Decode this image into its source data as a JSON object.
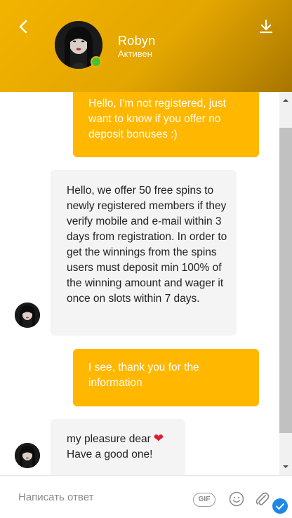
{
  "header": {
    "name": "Robyn",
    "status": "Активен",
    "online_color": "#41c23b",
    "background_color": "#f3b300"
  },
  "messages": [
    {
      "direction": "outgoing",
      "text": "Hello, I'm not registered, just want to know if you offer no deposit bonuses :)"
    },
    {
      "direction": "incoming",
      "text": "Hello, we offer 50 free spins to newly registered members if they verify mobile and e-mail within 3 days from registration. In order to get the winnings from the spins users must deposit min 100% of the winning amount and wager it once on slots within 7 days."
    },
    {
      "direction": "outgoing",
      "text": "I see, thank you for the information"
    },
    {
      "direction": "incoming",
      "text_line1": "my pleasure dear",
      "emoji": "heart",
      "text_line2": "Have a good one!"
    }
  ],
  "composer": {
    "placeholder": "Написать ответ",
    "gif_label": "GIF"
  },
  "icons": {
    "back": "chevron-left-icon",
    "download": "download-icon",
    "emoji": "smiley-icon",
    "attach": "paperclip-icon",
    "send": "checkmark-icon"
  },
  "colors": {
    "outgoing_bubble": "#ffb700",
    "incoming_bubble": "#f4f4f4",
    "accent_blue": "#1e88e5"
  }
}
